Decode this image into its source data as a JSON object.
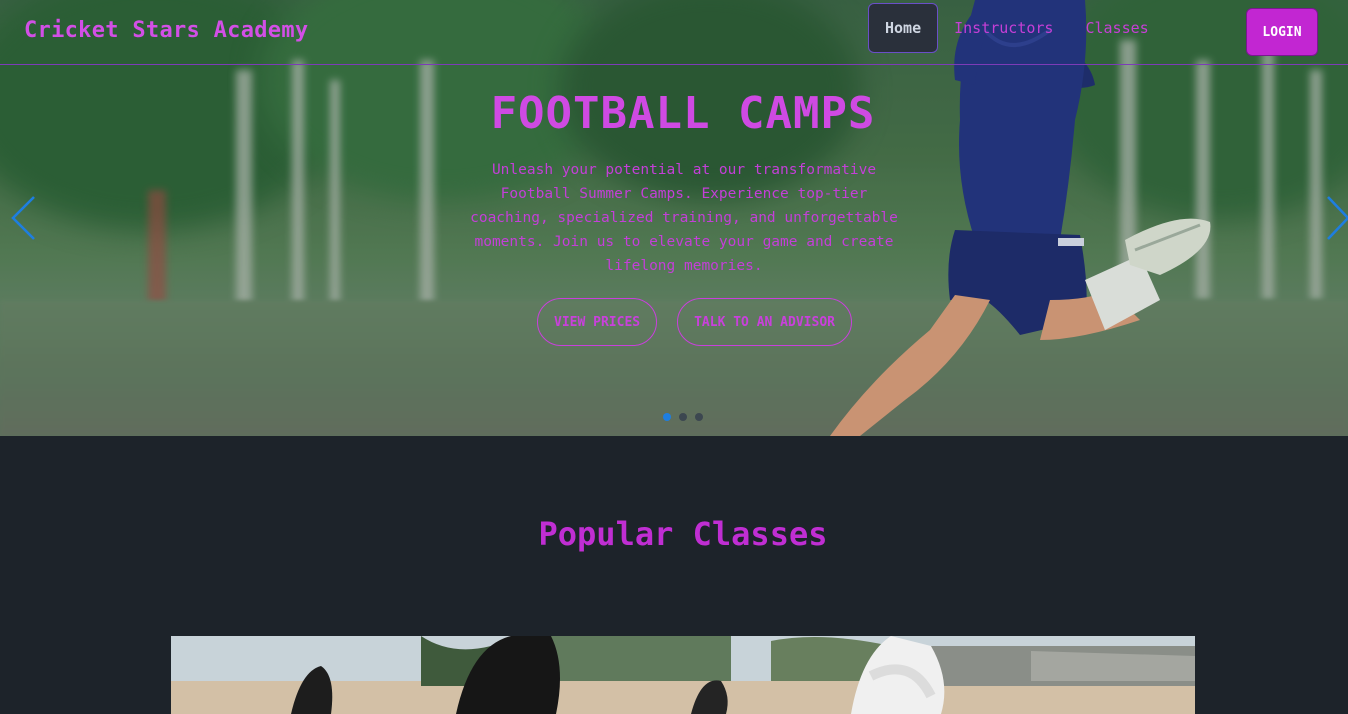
{
  "brand": "Cricket Stars Academy",
  "nav": {
    "items": [
      {
        "label": "Home",
        "active": true
      },
      {
        "label": "Instructors",
        "active": false
      },
      {
        "label": "Classes",
        "active": false
      }
    ],
    "theme_icon": "moon-icon",
    "login_label": "LOGIN"
  },
  "hero": {
    "title": "FOOTBALL CAMPS",
    "text": "Unleash your potential at our transformative Football Summer Camps. Experience top-tier coaching, specialized training, and unforgettable moments. Join us to elevate your game and create lifelong memories.",
    "primary_button": "VIEW PRICES",
    "secondary_button": "TALK TO AN ADVISOR",
    "prev_icon": "chevron-left-icon",
    "next_icon": "chevron-right-icon",
    "slides": 3,
    "active_slide": 1
  },
  "popular": {
    "title": "Popular Classes"
  },
  "colors": {
    "accent": "#c940dc",
    "background": "#1d232a",
    "login_bg": "#c226d2",
    "carousel_active": "#1e7ee0"
  }
}
